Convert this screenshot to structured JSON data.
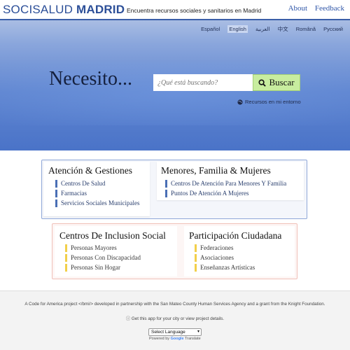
{
  "header": {
    "brand_thin": "SOCISALUD",
    "brand_bold": "MADRID",
    "tagline": "Encuentra recursos sociales y sanitarios en Madrid",
    "links": [
      "About",
      "Feedback"
    ]
  },
  "languages": {
    "items": [
      "Español",
      "English",
      "العربية",
      "中文",
      "Română",
      "Русский"
    ],
    "active": "English"
  },
  "hero": {
    "prompt": "Necesito...",
    "search_placeholder": "¿Qué está buscando?",
    "search_button": "Buscar",
    "near_link": "Recursos en mi entorno"
  },
  "categories": [
    {
      "title": "Atención & Gestiones",
      "items": [
        "Centros De Salud",
        "Farmacias",
        "Servicios Sociales Municipales"
      ]
    },
    {
      "title": "Menores, Familia & Mujeres",
      "items": [
        "Centros De Atención Para Menores Y Familia",
        "Puntos De Atención A Mujeres"
      ]
    },
    {
      "title": "Centros De Inclusion Social",
      "items": [
        "Personas Mayores",
        "Personas Con Discapacidad",
        "Personas Sin Hogar"
      ]
    },
    {
      "title": "Participación Ciudadana",
      "items": [
        "Federaciones",
        "Asociaciones",
        "Enseñanzas Artísticas"
      ]
    }
  ],
  "footer": {
    "credit": "A Code for America project </bmi/> developed in partnership with the San Mateo County Human Services Agency and a grant from the Knight Foundation.",
    "get_app": "Get this app for your city or view project details.",
    "select_label": "Select Language",
    "powered_prefix": "Powered by",
    "powered_google": "Google",
    "powered_suffix": "Translate"
  },
  "colors": {
    "brand": "#2c4f98",
    "hero_top": "#a9bde3",
    "hero_bottom": "#4a73c8",
    "search_button": "#c8ed9f",
    "blue_accent": "#4a6fb5",
    "yellow_accent": "#f2cf4a"
  }
}
